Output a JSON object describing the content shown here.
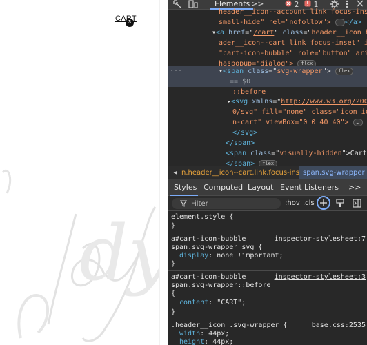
{
  "page": {
    "cart_label": "CART",
    "cart_count": "3",
    "watermark": "dy"
  },
  "devtools": {
    "tabs": {
      "elements": "Elements",
      "more": ">>"
    },
    "errors": "2",
    "warnings": "1",
    "dom": [
      {
        "id": "l0",
        "text": "header__icon--account link focus-inset"
      },
      {
        "id": "l1",
        "text": "small-hide\" rel=\"nofollow\">"
      },
      {
        "id": "l2a",
        "text": "header__icon he"
      },
      {
        "id": "l3",
        "text": "ader__icon--cart link focus-inset\" id="
      },
      {
        "id": "l4",
        "text": "\"cart-icon-bubble\" role=\"button\" aria-"
      },
      {
        "id": "l5",
        "text": "haspopup=\"dialog\">"
      },
      {
        "id": "l6",
        "text": "svg-wrapper"
      },
      {
        "id": "l7",
        "text": "== $0"
      },
      {
        "id": "l8",
        "text": "::before"
      },
      {
        "id": "l9a",
        "text": "http://www.w3.org/200"
      },
      {
        "id": "l10",
        "text": "0/svg\" fill=\"none\" class=\"icon ico"
      },
      {
        "id": "l11",
        "text": "n-cart\" viewBox=\"0 0 40 40\">"
      },
      {
        "id": "l14",
        "text": "visually-hidden"
      },
      {
        "id": "l14b",
        "text": "Cart"
      }
    ],
    "dom_flex": "flex",
    "dom_href": "/cart",
    "dom_ellipsis": "…",
    "breadcrumbs": {
      "a": "n.header__icon--cart.link.focus-inset",
      "b": "span.svg-wrapper"
    },
    "subtabs": [
      "Styles",
      "Computed",
      "Layout",
      "Event Listeners",
      ">>"
    ],
    "filter_placeholder": "Filter",
    "hov": ":hov",
    "cls": ".cls",
    "styles": {
      "element_style": "element.style {",
      "close": "}",
      "r1_sel1": "a#cart-icon-bubble",
      "r1_sel2": "span.svg-wrapper svg {",
      "r1_src": "inspector-stylesheet:7",
      "r1_prop": "display",
      "r1_val": "none !important;",
      "r2_sel1": "a#cart-icon-bubble",
      "r2_sel2": "span.svg-wrapper::before",
      "r2_open": "{",
      "r2_src": "inspector-stylesheet:3",
      "r2_prop": "content",
      "r2_val": "\"CART\";",
      "r3_sel": ".header__icon .svg-wrapper {",
      "r3_src": "base.css:2535",
      "r3_p1": "width",
      "r3_v1": "44px;",
      "r3_p2": "height",
      "r3_v2": "44px;"
    }
  }
}
